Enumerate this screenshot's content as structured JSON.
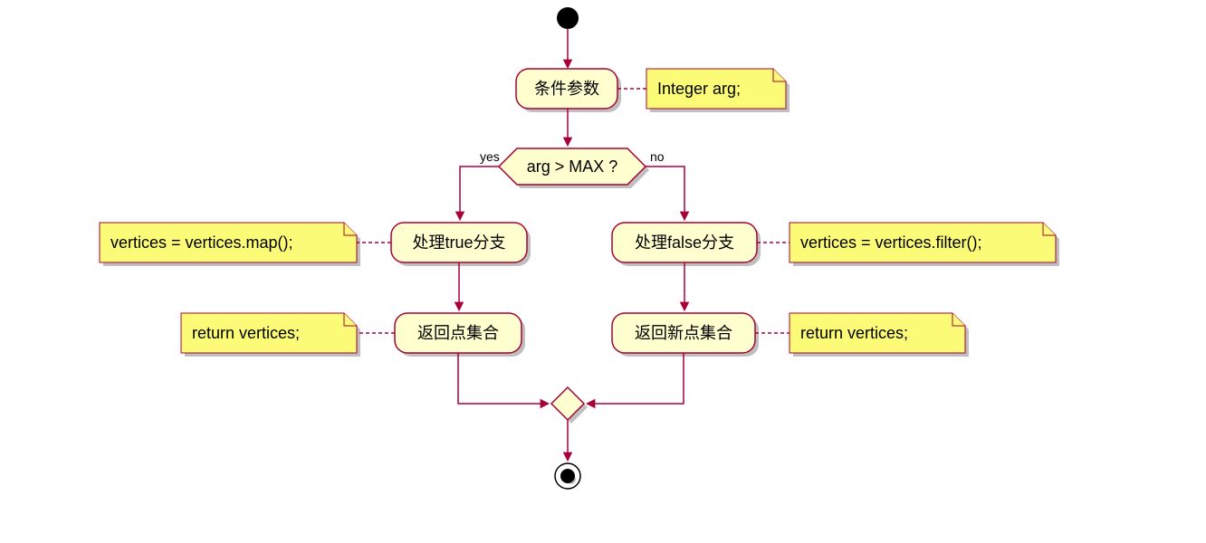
{
  "chart_data": {
    "type": "flowchart",
    "nodes": [
      {
        "id": "start",
        "type": "start"
      },
      {
        "id": "n1",
        "label": "条件参数",
        "note": "Integer arg;"
      },
      {
        "id": "d1",
        "type": "decision",
        "label": "arg > MAX ?",
        "yes": "yes",
        "no": "no"
      },
      {
        "id": "n2",
        "label": "处理true分支",
        "note": "vertices = vertices.map();",
        "branch": "yes"
      },
      {
        "id": "n3",
        "label": "返回点集合",
        "note": "return vertices;",
        "branch": "yes"
      },
      {
        "id": "n4",
        "label": "处理false分支",
        "note": "vertices = vertices.filter();",
        "branch": "no"
      },
      {
        "id": "n5",
        "label": "返回新点集合",
        "note": "return vertices;",
        "branch": "no"
      },
      {
        "id": "merge",
        "type": "merge"
      },
      {
        "id": "end",
        "type": "end"
      }
    ],
    "edges": [
      [
        "start",
        "n1"
      ],
      [
        "n1",
        "d1"
      ],
      [
        "d1",
        "n2",
        "yes"
      ],
      [
        "n2",
        "n3"
      ],
      [
        "n3",
        "merge"
      ],
      [
        "d1",
        "n4",
        "no"
      ],
      [
        "n4",
        "n5"
      ],
      [
        "n5",
        "merge"
      ],
      [
        "merge",
        "end"
      ]
    ]
  },
  "labels": {
    "n1": "条件参数",
    "note1": "Integer arg;",
    "d1": "arg > MAX ?",
    "yes": "yes",
    "no": "no",
    "n2": "处理true分支",
    "note2": "vertices = vertices.map();",
    "n3": "返回点集合",
    "note3": "return vertices;",
    "n4": "处理false分支",
    "note4": "vertices = vertices.filter();",
    "n5": "返回新点集合",
    "note5": "return vertices;"
  }
}
